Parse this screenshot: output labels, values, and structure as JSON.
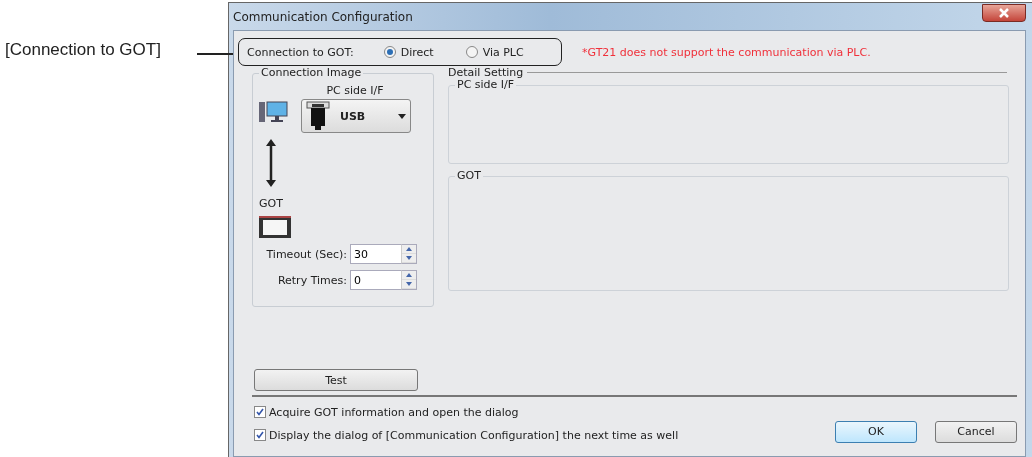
{
  "callout": {
    "label": "[Connection to GOT]"
  },
  "window": {
    "title": "Communication Configuration"
  },
  "connection": {
    "label": "Connection to GOT:",
    "options": [
      {
        "label": "Direct",
        "selected": true
      },
      {
        "label": "Via PLC",
        "selected": false
      }
    ],
    "note": "*GT21 does not support the communication via PLC."
  },
  "connection_image": {
    "title": "Connection Image",
    "pc_side_label": "PC side I/F",
    "interface": "USB",
    "got_label": "GOT",
    "fields": [
      {
        "label": "Timeout (Sec):",
        "value": "30"
      },
      {
        "label": "Retry Times:",
        "value": "0"
      }
    ]
  },
  "detail_setting": {
    "title": "Detail Setting",
    "groups": [
      "PC side I/F",
      "GOT"
    ]
  },
  "test_button": "Test",
  "options": [
    {
      "label": "Acquire GOT information and open the dialog",
      "checked": true
    },
    {
      "label": "Display the dialog of [Communication Configuration] the next time as well",
      "checked": true
    }
  ],
  "buttons": [
    {
      "label": "OK",
      "kind": "default"
    },
    {
      "label": "Cancel",
      "kind": "normal"
    }
  ]
}
